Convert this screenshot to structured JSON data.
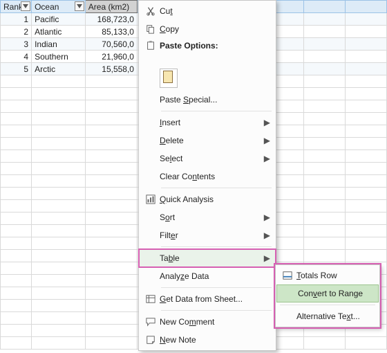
{
  "columns": [
    "Rank",
    "Ocean",
    "Area (km2)"
  ],
  "rows": [
    {
      "rank": 1,
      "ocean": "Pacific",
      "area": "168,723,0"
    },
    {
      "rank": 2,
      "ocean": "Atlantic",
      "area": "85,133,0"
    },
    {
      "rank": 3,
      "ocean": "Indian",
      "area": "70,560,0"
    },
    {
      "rank": 4,
      "ocean": "Southern",
      "area": "21,960,0"
    },
    {
      "rank": 5,
      "ocean": "Arctic",
      "area": "15,558,0"
    }
  ],
  "context_menu": {
    "cut": {
      "html": "Cu<u>t</u>"
    },
    "copy": {
      "html": "<u>C</u>opy"
    },
    "paste_options": {
      "html": "<b>Paste Options:</b>"
    },
    "paste_special": {
      "html": "Paste <u>S</u>pecial..."
    },
    "insert": {
      "html": "<u>I</u>nsert"
    },
    "delete": {
      "html": "<u>D</u>elete"
    },
    "select": {
      "html": "Se<u>l</u>ect"
    },
    "clear_contents": {
      "html": "Clear Co<u>n</u>tents"
    },
    "quick_analysis": {
      "html": "<u>Q</u>uick Analysis"
    },
    "sort": {
      "html": "S<u>o</u>rt"
    },
    "filter": {
      "html": "Filt<u>e</u>r"
    },
    "table": {
      "html": "Ta<u>b</u>le"
    },
    "analyze_data": {
      "html": "Analy<u>z</u>e Data"
    },
    "get_data": {
      "html": "<u>G</u>et Data from Sheet..."
    },
    "new_comment": {
      "html": "New Co<u>m</u>ment"
    },
    "new_note": {
      "html": "<u>N</u>ew Note"
    }
  },
  "submenu": {
    "totals_row": {
      "html": "<u>T</u>otals Row"
    },
    "convert_to_range": {
      "html": "Con<u>v</u>ert to Range"
    },
    "alternative_text": {
      "html": "Alternative Te<u>x</u>t..."
    }
  }
}
